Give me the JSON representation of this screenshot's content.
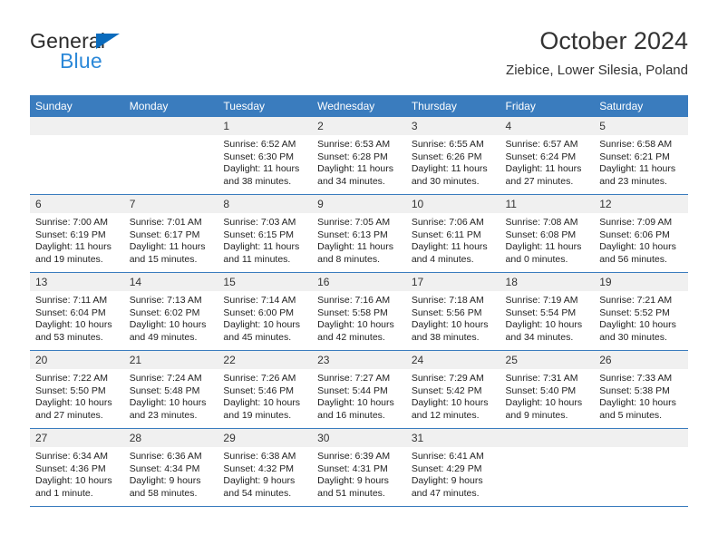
{
  "logo": {
    "word_top": "General",
    "word_bottom": "Blue",
    "triangle_color": "#0a6bbd",
    "blue_text_color": "#2b88d8"
  },
  "header": {
    "title": "October 2024",
    "subtitle": "Ziebice, Lower Silesia, Poland",
    "header_bg": "#3a7cbe",
    "daynum_bg": "#f0f0f0"
  },
  "weekday_headers": [
    "Sunday",
    "Monday",
    "Tuesday",
    "Wednesday",
    "Thursday",
    "Friday",
    "Saturday"
  ],
  "labels": {
    "sunrise": "Sunrise:",
    "sunset": "Sunset:",
    "daylight": "Daylight:"
  },
  "weeks": [
    [
      {
        "day": "",
        "empty": true
      },
      {
        "day": "",
        "empty": true
      },
      {
        "day": "1",
        "sunrise": "Sunrise: 6:52 AM",
        "sunset": "Sunset: 6:30 PM",
        "daylight": "Daylight: 11 hours and 38 minutes."
      },
      {
        "day": "2",
        "sunrise": "Sunrise: 6:53 AM",
        "sunset": "Sunset: 6:28 PM",
        "daylight": "Daylight: 11 hours and 34 minutes."
      },
      {
        "day": "3",
        "sunrise": "Sunrise: 6:55 AM",
        "sunset": "Sunset: 6:26 PM",
        "daylight": "Daylight: 11 hours and 30 minutes."
      },
      {
        "day": "4",
        "sunrise": "Sunrise: 6:57 AM",
        "sunset": "Sunset: 6:24 PM",
        "daylight": "Daylight: 11 hours and 27 minutes."
      },
      {
        "day": "5",
        "sunrise": "Sunrise: 6:58 AM",
        "sunset": "Sunset: 6:21 PM",
        "daylight": "Daylight: 11 hours and 23 minutes."
      }
    ],
    [
      {
        "day": "6",
        "sunrise": "Sunrise: 7:00 AM",
        "sunset": "Sunset: 6:19 PM",
        "daylight": "Daylight: 11 hours and 19 minutes."
      },
      {
        "day": "7",
        "sunrise": "Sunrise: 7:01 AM",
        "sunset": "Sunset: 6:17 PM",
        "daylight": "Daylight: 11 hours and 15 minutes."
      },
      {
        "day": "8",
        "sunrise": "Sunrise: 7:03 AM",
        "sunset": "Sunset: 6:15 PM",
        "daylight": "Daylight: 11 hours and 11 minutes."
      },
      {
        "day": "9",
        "sunrise": "Sunrise: 7:05 AM",
        "sunset": "Sunset: 6:13 PM",
        "daylight": "Daylight: 11 hours and 8 minutes."
      },
      {
        "day": "10",
        "sunrise": "Sunrise: 7:06 AM",
        "sunset": "Sunset: 6:11 PM",
        "daylight": "Daylight: 11 hours and 4 minutes."
      },
      {
        "day": "11",
        "sunrise": "Sunrise: 7:08 AM",
        "sunset": "Sunset: 6:08 PM",
        "daylight": "Daylight: 11 hours and 0 minutes."
      },
      {
        "day": "12",
        "sunrise": "Sunrise: 7:09 AM",
        "sunset": "Sunset: 6:06 PM",
        "daylight": "Daylight: 10 hours and 56 minutes."
      }
    ],
    [
      {
        "day": "13",
        "sunrise": "Sunrise: 7:11 AM",
        "sunset": "Sunset: 6:04 PM",
        "daylight": "Daylight: 10 hours and 53 minutes."
      },
      {
        "day": "14",
        "sunrise": "Sunrise: 7:13 AM",
        "sunset": "Sunset: 6:02 PM",
        "daylight": "Daylight: 10 hours and 49 minutes."
      },
      {
        "day": "15",
        "sunrise": "Sunrise: 7:14 AM",
        "sunset": "Sunset: 6:00 PM",
        "daylight": "Daylight: 10 hours and 45 minutes."
      },
      {
        "day": "16",
        "sunrise": "Sunrise: 7:16 AM",
        "sunset": "Sunset: 5:58 PM",
        "daylight": "Daylight: 10 hours and 42 minutes."
      },
      {
        "day": "17",
        "sunrise": "Sunrise: 7:18 AM",
        "sunset": "Sunset: 5:56 PM",
        "daylight": "Daylight: 10 hours and 38 minutes."
      },
      {
        "day": "18",
        "sunrise": "Sunrise: 7:19 AM",
        "sunset": "Sunset: 5:54 PM",
        "daylight": "Daylight: 10 hours and 34 minutes."
      },
      {
        "day": "19",
        "sunrise": "Sunrise: 7:21 AM",
        "sunset": "Sunset: 5:52 PM",
        "daylight": "Daylight: 10 hours and 30 minutes."
      }
    ],
    [
      {
        "day": "20",
        "sunrise": "Sunrise: 7:22 AM",
        "sunset": "Sunset: 5:50 PM",
        "daylight": "Daylight: 10 hours and 27 minutes."
      },
      {
        "day": "21",
        "sunrise": "Sunrise: 7:24 AM",
        "sunset": "Sunset: 5:48 PM",
        "daylight": "Daylight: 10 hours and 23 minutes."
      },
      {
        "day": "22",
        "sunrise": "Sunrise: 7:26 AM",
        "sunset": "Sunset: 5:46 PM",
        "daylight": "Daylight: 10 hours and 19 minutes."
      },
      {
        "day": "23",
        "sunrise": "Sunrise: 7:27 AM",
        "sunset": "Sunset: 5:44 PM",
        "daylight": "Daylight: 10 hours and 16 minutes."
      },
      {
        "day": "24",
        "sunrise": "Sunrise: 7:29 AM",
        "sunset": "Sunset: 5:42 PM",
        "daylight": "Daylight: 10 hours and 12 minutes."
      },
      {
        "day": "25",
        "sunrise": "Sunrise: 7:31 AM",
        "sunset": "Sunset: 5:40 PM",
        "daylight": "Daylight: 10 hours and 9 minutes."
      },
      {
        "day": "26",
        "sunrise": "Sunrise: 7:33 AM",
        "sunset": "Sunset: 5:38 PM",
        "daylight": "Daylight: 10 hours and 5 minutes."
      }
    ],
    [
      {
        "day": "27",
        "sunrise": "Sunrise: 6:34 AM",
        "sunset": "Sunset: 4:36 PM",
        "daylight": "Daylight: 10 hours and 1 minute."
      },
      {
        "day": "28",
        "sunrise": "Sunrise: 6:36 AM",
        "sunset": "Sunset: 4:34 PM",
        "daylight": "Daylight: 9 hours and 58 minutes."
      },
      {
        "day": "29",
        "sunrise": "Sunrise: 6:38 AM",
        "sunset": "Sunset: 4:32 PM",
        "daylight": "Daylight: 9 hours and 54 minutes."
      },
      {
        "day": "30",
        "sunrise": "Sunrise: 6:39 AM",
        "sunset": "Sunset: 4:31 PM",
        "daylight": "Daylight: 9 hours and 51 minutes."
      },
      {
        "day": "31",
        "sunrise": "Sunrise: 6:41 AM",
        "sunset": "Sunset: 4:29 PM",
        "daylight": "Daylight: 9 hours and 47 minutes."
      },
      {
        "day": "",
        "empty": true
      },
      {
        "day": "",
        "empty": true
      }
    ]
  ]
}
